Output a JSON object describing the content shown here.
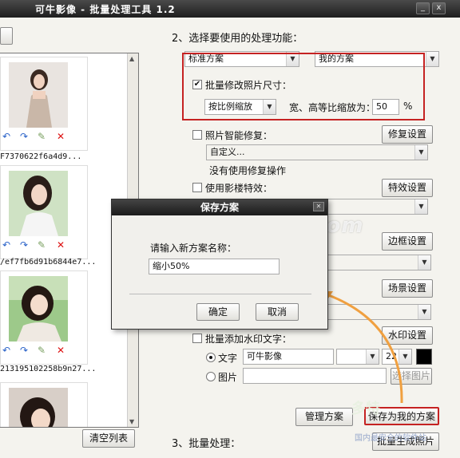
{
  "window": {
    "title": "可牛影像 - 批量处理工具 1.2",
    "min": "_",
    "close": "x"
  },
  "left": {
    "thumbnails": [
      {
        "name": "F7370622f6a4d9..."
      },
      {
        "name": "/ef7fb6d91b6844e7..."
      },
      {
        "name": "213195102258b9n27..."
      },
      {
        "name": ""
      }
    ],
    "clear_label": "清空列表"
  },
  "step2": {
    "title": "2、选择要使用的处理功能："
  },
  "preset": {
    "left": "标准方案",
    "right": "我的方案"
  },
  "resize": {
    "label": "批量修改照片尺寸：",
    "mode": "按比例缩放",
    "ratio_label": "宽、高等比缩放为：",
    "ratio_value": "50",
    "unit": "%"
  },
  "repair": {
    "label": "照片智能修复：",
    "select": "自定义...",
    "note": "没有使用修复操作",
    "button": "修复设置"
  },
  "effect": {
    "label": "使用影楼特效：",
    "button": "特效设置"
  },
  "border": {
    "button": "边框设置"
  },
  "scene": {
    "button": "场景设置"
  },
  "watermark": {
    "label": "批量添加水印文字：",
    "button": "水印设置",
    "text_radio": "文字",
    "text_value": "可牛影像",
    "font_size": "22",
    "image_radio": "图片",
    "browse": "选择图片"
  },
  "actions": {
    "manage": "管理方案",
    "save_mine": "保存为我的方案"
  },
  "step3": {
    "title": "3、批量处理：",
    "generate": "批量生成照片"
  },
  "dialog": {
    "title": "保存方案",
    "prompt": "请输入新方案名称：",
    "value": "缩小50%",
    "ok": "确定",
    "cancel": "取消"
  },
  "overlay": {
    "watermark": "www.DuoTe.com",
    "corner_logo": "多特",
    "corner_sub": "国内最安全的软件站"
  },
  "colors": {
    "highlight_red": "#c52222",
    "arrow_orange": "#f0a040"
  }
}
